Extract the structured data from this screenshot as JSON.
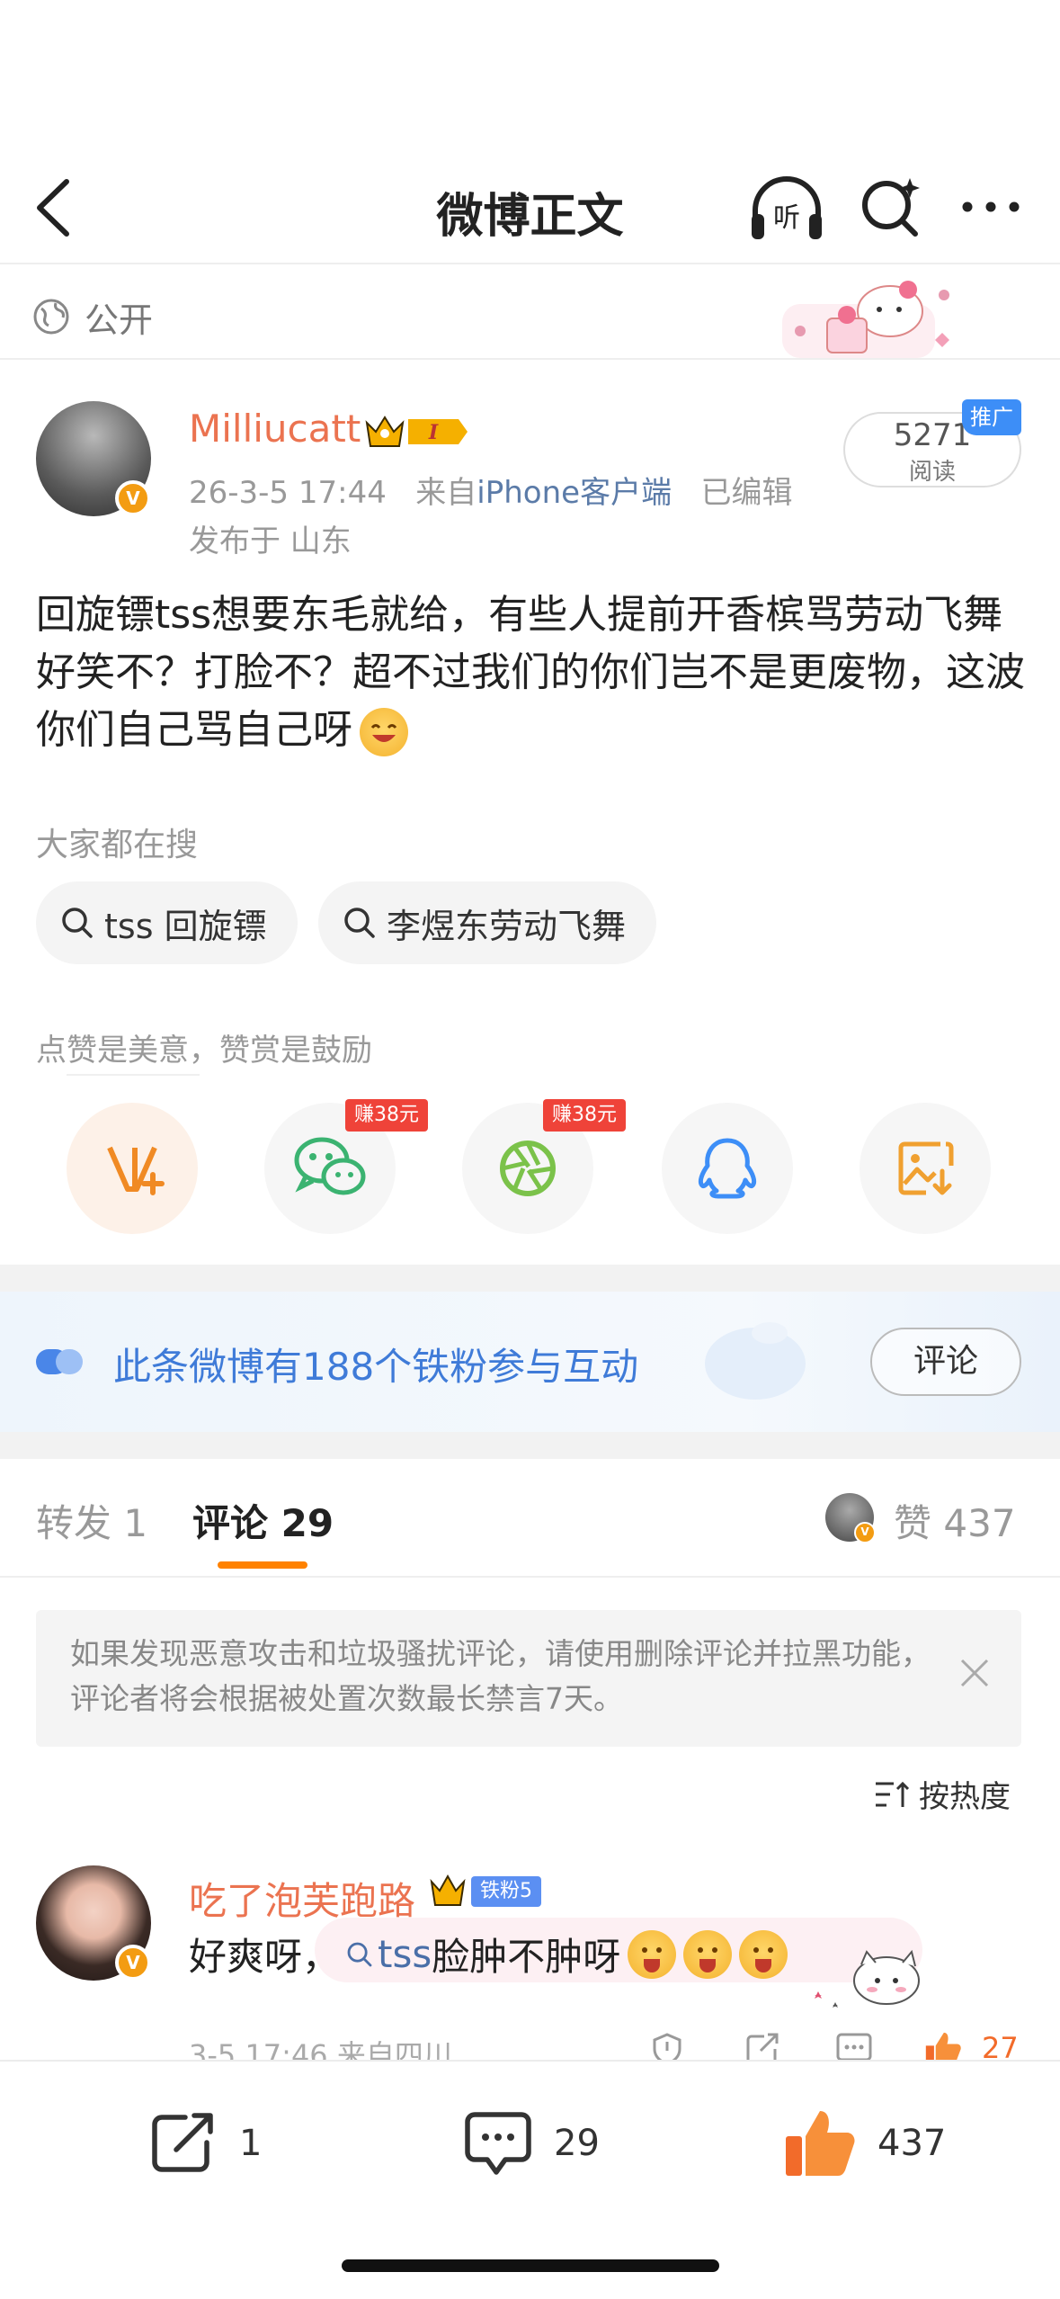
{
  "nav": {
    "title": "微博正文"
  },
  "visibility": {
    "label": "公开"
  },
  "post": {
    "author": "Milliucatt",
    "level_badge": "I",
    "time": "26-3-5 17:44",
    "from_prefix": "来自",
    "source": "iPhone客户端",
    "edited": "已编辑",
    "location": "发布于 山东",
    "reads": "5271",
    "reads_label": "阅读",
    "promo": "推广",
    "content": "回旋镖tss想要东毛就给，有些人提前开香槟骂劳动飞舞好笑不？打脸不？超不过我们的你们岂不是更废物，这波你们自己骂自己呀"
  },
  "hot_search": {
    "title": "大家都在搜",
    "chips": [
      "tss 回旋镖",
      "李煜东劳动飞舞"
    ]
  },
  "praise": {
    "title": "点赞是美意，赞赏是鼓励",
    "earn_labels": [
      "赚38元",
      "赚38元"
    ]
  },
  "fans": {
    "text": "此条微博有188个铁粉参与互动",
    "button": "评论"
  },
  "tabs": {
    "repost": "转发 1",
    "comments_label": "评论",
    "comments_count": "29",
    "likes_label": "赞",
    "likes_count": "437"
  },
  "notice": {
    "text": "如果发现恶意攻击和垃圾骚扰评论，请使用删除评论并拉黑功能，评论者将会根据被处置次数最长禁言7天。"
  },
  "sort": {
    "label": "按热度"
  },
  "comment": {
    "author": "吃了泡芙跑路",
    "fan_badge": "铁粉5",
    "text_prefix": "好爽呀，",
    "topic": "tss",
    "text_suffix": "脸肿不肿呀",
    "meta": "3-5 17:46  来自四川",
    "likes": "27"
  },
  "bottom_bar": {
    "repost_count": "1",
    "comment_count": "29",
    "like_count": "437"
  },
  "colors": {
    "accent_orange": "#ff8200",
    "name_orange": "#eb7350",
    "link_blue": "#5b7ba8",
    "fans_blue": "#3f7bd8",
    "earn_red": "#ef4339"
  }
}
